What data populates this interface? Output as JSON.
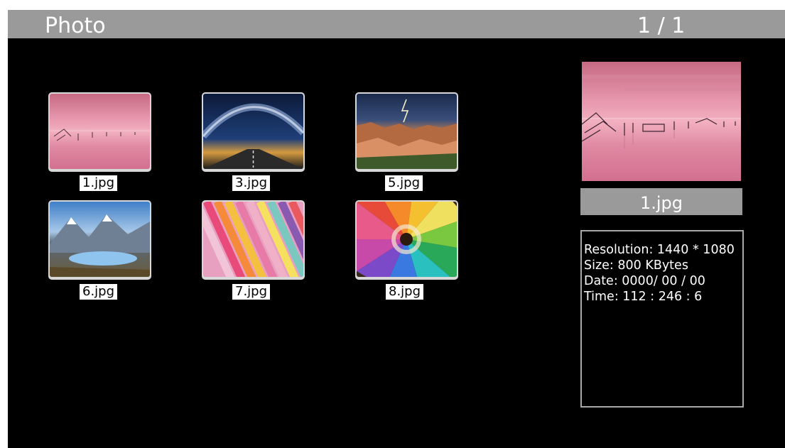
{
  "header": {
    "title": "Photo",
    "page_indicator": "1 / 1"
  },
  "thumbnails": [
    {
      "name": "1.jpg",
      "image": "pink-sea-sunset"
    },
    {
      "name": "3.jpg",
      "image": "milky-way-road"
    },
    {
      "name": "5.jpg",
      "image": "canyon-lightning"
    },
    {
      "name": "6.jpg",
      "image": "mountain-lake"
    },
    {
      "name": "7.jpg",
      "image": "colored-paper-stripes"
    },
    {
      "name": "8.jpg",
      "image": "colored-pencils"
    }
  ],
  "preview": {
    "image": "pink-sea-sunset",
    "filename": "1.jpg",
    "info": {
      "resolution": "Resolution: 1440 * 1080",
      "size": "Size: 800 KBytes",
      "date": "Date: 0000/ 00 / 00",
      "time": "Time: 112 : 246 : 6"
    }
  },
  "colors": {
    "header_bar": "#9a9a9a",
    "background": "#000000",
    "text": "#ffffff"
  }
}
